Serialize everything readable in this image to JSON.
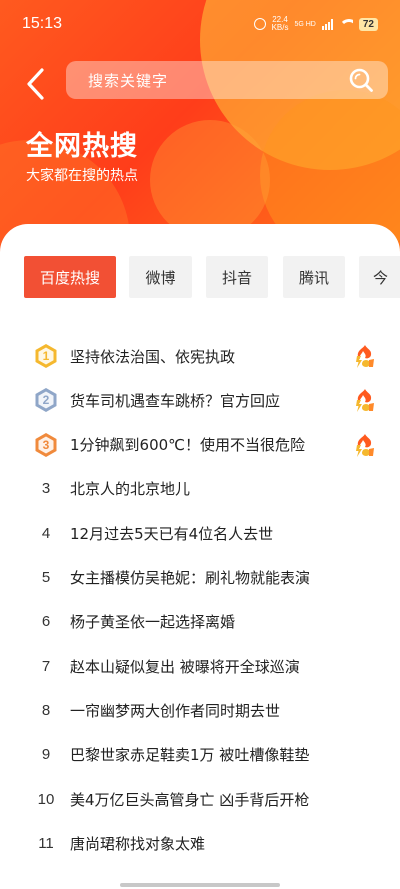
{
  "status_bar": {
    "time": "15:13",
    "net_speed_value": "22.4",
    "net_speed_unit": "KB/s",
    "signal_label": "5G HD",
    "battery": "72"
  },
  "header": {
    "search_placeholder": "搜索关键字",
    "title": "全网热搜",
    "subtitle": "大家都在搜的热点"
  },
  "tabs": [
    {
      "label": "百度热搜",
      "active": true
    },
    {
      "label": "微博",
      "active": false
    },
    {
      "label": "抖音",
      "active": false
    },
    {
      "label": "腾讯",
      "active": false
    },
    {
      "label": "今",
      "active": false
    }
  ],
  "hot_list": [
    {
      "rank": "1",
      "title": "坚持依法治国、依宪执政",
      "badge": "gold",
      "hot": true
    },
    {
      "rank": "2",
      "title": "货车司机遇查车跳桥？官方回应",
      "badge": "silver",
      "hot": true
    },
    {
      "rank": "3",
      "title": "1分钟飙到600℃！使用不当很危险",
      "badge": "bronze",
      "hot": true
    },
    {
      "rank": "3",
      "title": "北京人的北京地儿",
      "badge": "none",
      "hot": false
    },
    {
      "rank": "4",
      "title": "12月过去5天已有4位名人去世",
      "badge": "none",
      "hot": false
    },
    {
      "rank": "5",
      "title": "女主播模仿吴艳妮：刷礼物就能表演",
      "badge": "none",
      "hot": false
    },
    {
      "rank": "6",
      "title": "杨子黄圣依一起选择离婚",
      "badge": "none",
      "hot": false
    },
    {
      "rank": "7",
      "title": "赵本山疑似复出 被曝将开全球巡演",
      "badge": "none",
      "hot": false
    },
    {
      "rank": "8",
      "title": "一帘幽梦两大创作者同时期去世",
      "badge": "none",
      "hot": false
    },
    {
      "rank": "9",
      "title": "巴黎世家赤足鞋卖1万 被吐槽像鞋垫",
      "badge": "none",
      "hot": false
    },
    {
      "rank": "10",
      "title": "美4万亿巨头高管身亡 凶手背后开枪",
      "badge": "none",
      "hot": false
    },
    {
      "rank": "11",
      "title": "唐尚珺称找对象太难",
      "badge": "none",
      "hot": false
    }
  ],
  "colors": {
    "accent": "#f25034",
    "gold": "#f5b82e",
    "silver": "#8fa6c8",
    "bronze": "#f08a3c",
    "hot": "#ff5a1f"
  },
  "icons": {
    "back": "chevron-left-icon",
    "search": "search-icon",
    "hot": "hot-flame-icon"
  }
}
